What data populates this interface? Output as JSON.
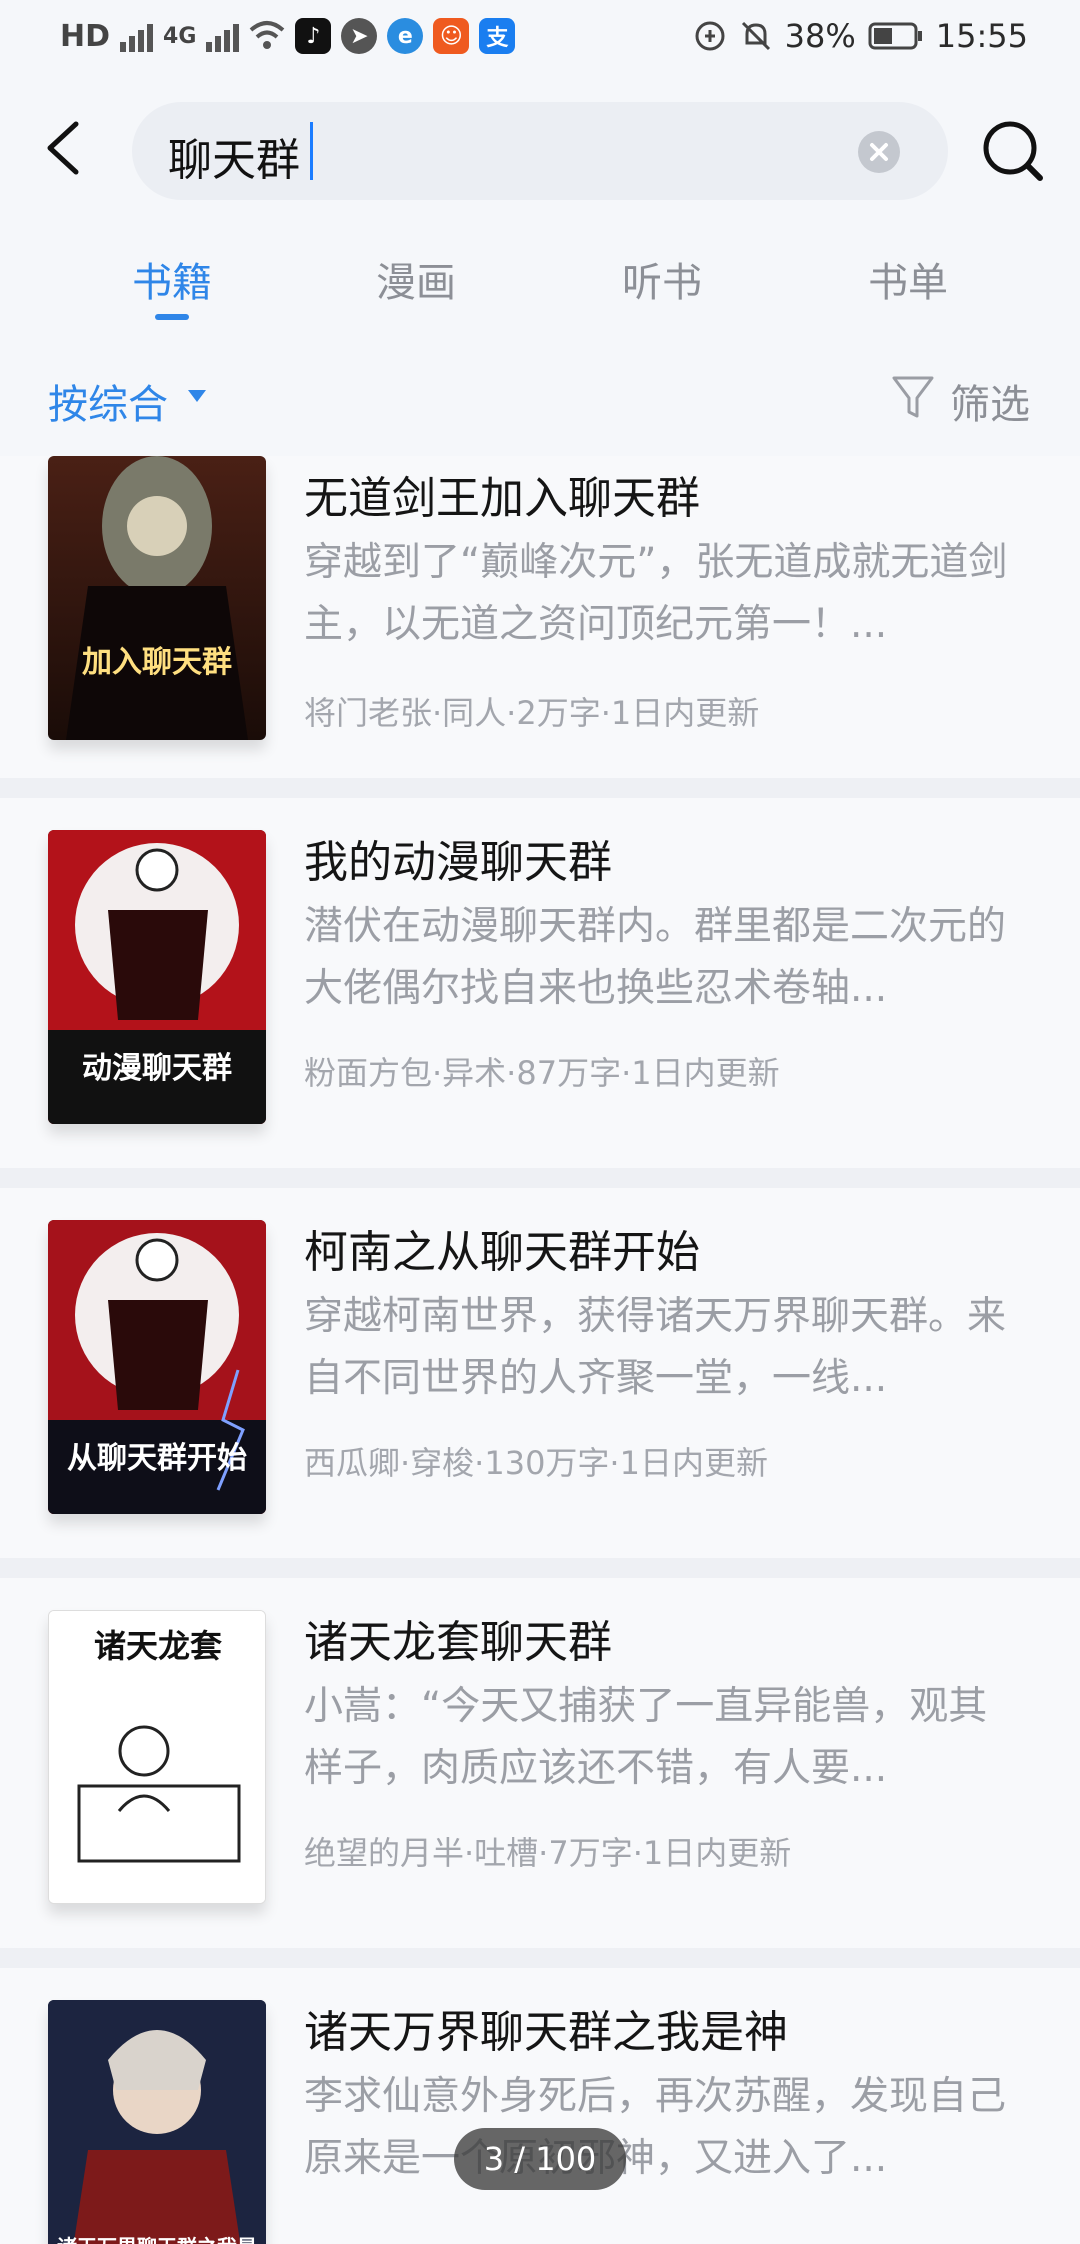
{
  "status_bar": {
    "left_text": "HD",
    "network": "4G",
    "battery": "38%",
    "time": "15:55",
    "app_icons": [
      "tiktok-icon",
      "compass-icon",
      "browser-icon",
      "taobao-icon",
      "alipay-icon"
    ]
  },
  "search": {
    "query": "聊天群",
    "placeholder": ""
  },
  "tabs": [
    {
      "label": "书籍",
      "active": true
    },
    {
      "label": "漫画",
      "active": false
    },
    {
      "label": "听书",
      "active": false
    },
    {
      "label": "书单",
      "active": false
    }
  ],
  "filter_bar": {
    "sort_label": "按综合",
    "filter_label": "筛选"
  },
  "books": [
    {
      "title": "无道剑王加入聊天群",
      "desc": "穿越到了“巅峰次元”，张无道成就无道剑主，以无道之资问顶纪元第一！...",
      "meta": "将门老张·同人·2万字·1日内更新",
      "cover_text": "加入聊天群",
      "cover_color": "#3a1a12"
    },
    {
      "title": "我的动漫聊天群",
      "desc": "潜伏在动漫聊天群内。群里都是二次元的大佬偶尔找自来也换些忍术卷轴...",
      "meta": "粉面方包·异术·87万字·1日内更新",
      "cover_text": "动漫聊天群",
      "cover_color": "#b3121a"
    },
    {
      "title": "柯南之从聊天群开始",
      "desc": "穿越柯南世界，获得诸天万界聊天群。来自不同世界的人齐聚一堂，一线...",
      "meta": "西瓜卿·穿梭·130万字·1日内更新",
      "cover_text": "从聊天群开始",
      "cover_color": "#a5121b"
    },
    {
      "title": "诸天龙套聊天群",
      "desc": "小嵩：“今天又捕获了一直异能兽，观其样子，肉质应该还不错，有人要...",
      "meta": "绝望的月半·吐槽·7万字·1日内更新",
      "cover_text": "诸天龙套",
      "cover_color": "#ffffff"
    },
    {
      "title": "诸天万界聊天群之我是神",
      "desc": "李求仙意外身死后，再次苏醒，发现自己原来是一个原初邪神，又进入了...",
      "meta": "",
      "cover_text": "诸天万界聊天群之我是神",
      "cover_color": "#1c2440"
    }
  ],
  "pager": "3 / 100",
  "colors": {
    "accent": "#2f86e8",
    "background": "#f5f7fa"
  }
}
